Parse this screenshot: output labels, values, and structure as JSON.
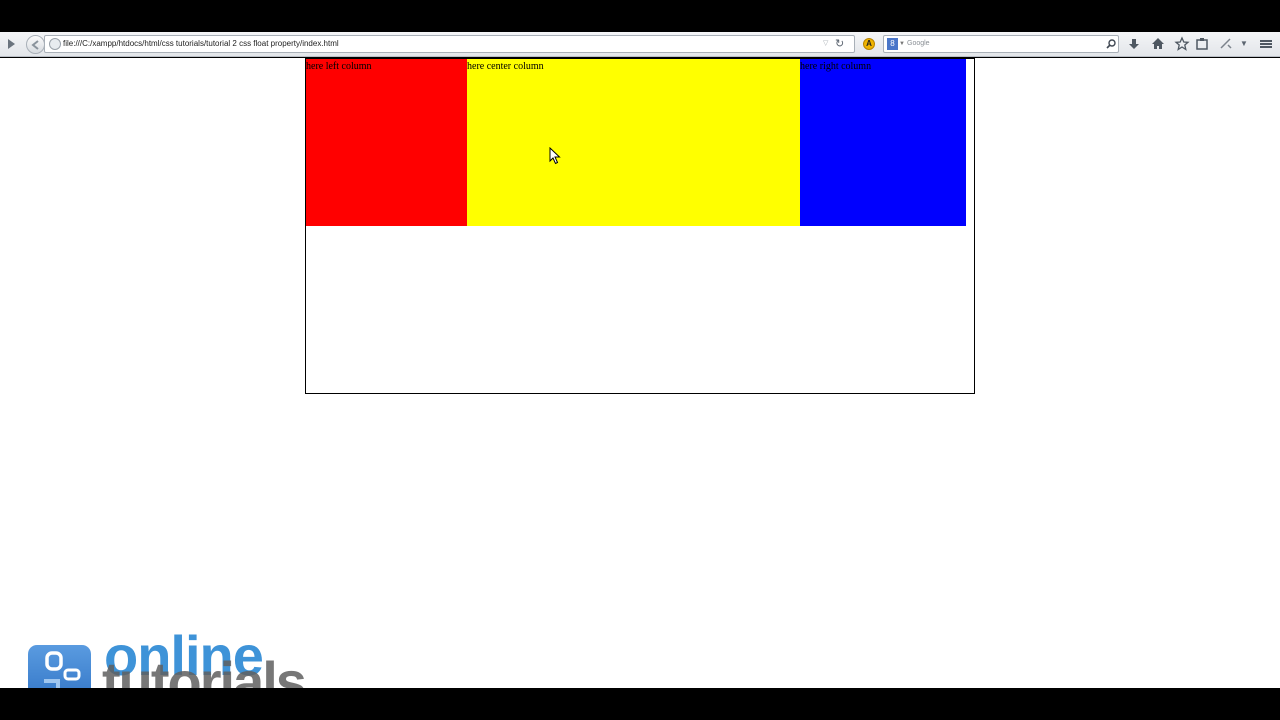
{
  "browser": {
    "url": "file:///C:/xampp/htdocs/html/css tutorials/tutorial 2  css float property/index.html",
    "search_placeholder": "Google",
    "search_engine_letter": "8"
  },
  "page": {
    "columns": [
      {
        "label": "here left column",
        "color": "#ff0000"
      },
      {
        "label": "here center column",
        "color": "#ffff00"
      },
      {
        "label": "here right column",
        "color": "#0000ff"
      }
    ]
  },
  "watermark": {
    "line1": "online",
    "line2": "tutorials"
  },
  "icons": {
    "back": "back-arrow-icon",
    "reload": "reload-icon",
    "search_go": "magnifier-icon",
    "download": "download-icon",
    "home": "home-icon",
    "bookmark": "star-icon",
    "clipboard": "clipboard-icon",
    "menu": "hamburger-icon"
  }
}
